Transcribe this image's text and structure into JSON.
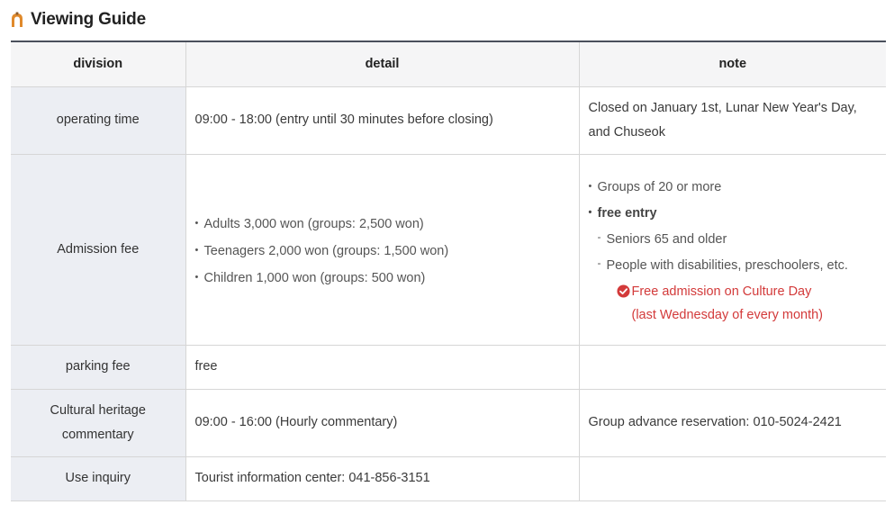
{
  "title": "Viewing Guide",
  "icons": {
    "title_icon": "arch-gate-icon",
    "red_note_icon": "check-circle-icon"
  },
  "colors": {
    "accent_red": "#d33a3a",
    "header_rule": "#4a4f5c",
    "icon_orange": "#e08a2c"
  },
  "table": {
    "headers": {
      "division": "division",
      "detail": "detail",
      "note": "note"
    },
    "operating": {
      "division": "operating time",
      "detail": "09:00 - 18:00 (entry until 30 minutes before closing)",
      "note": "Closed on January 1st, Lunar New Year's Day, and Chuseok"
    },
    "admission": {
      "division": "Admission fee",
      "detail": [
        "Adults 3,000 won (groups: 2,500 won)",
        "Teenagers 2,000 won (groups: 1,500 won)",
        "Children 1,000 won (groups: 500 won)"
      ],
      "note": {
        "groups": "Groups of 20 or more",
        "free_entry": "free entry",
        "seniors": "Seniors 65 and older",
        "disabilities": "People with disabilities, preschoolers, etc.",
        "culture_day_line1": "Free admission on Culture Day",
        "culture_day_line2": "(last Wednesday of every month)"
      }
    },
    "parking": {
      "division": "parking fee",
      "detail": "free",
      "note": ""
    },
    "commentary": {
      "division_line1": "Cultural heritage",
      "division_line2": "commentary",
      "detail": "09:00 - 16:00 (Hourly commentary)",
      "note": "Group advance reservation: 010-5024-2421"
    },
    "inquiry": {
      "division": "Use inquiry",
      "detail": "Tourist information center: 041-856-3151",
      "note": ""
    }
  }
}
